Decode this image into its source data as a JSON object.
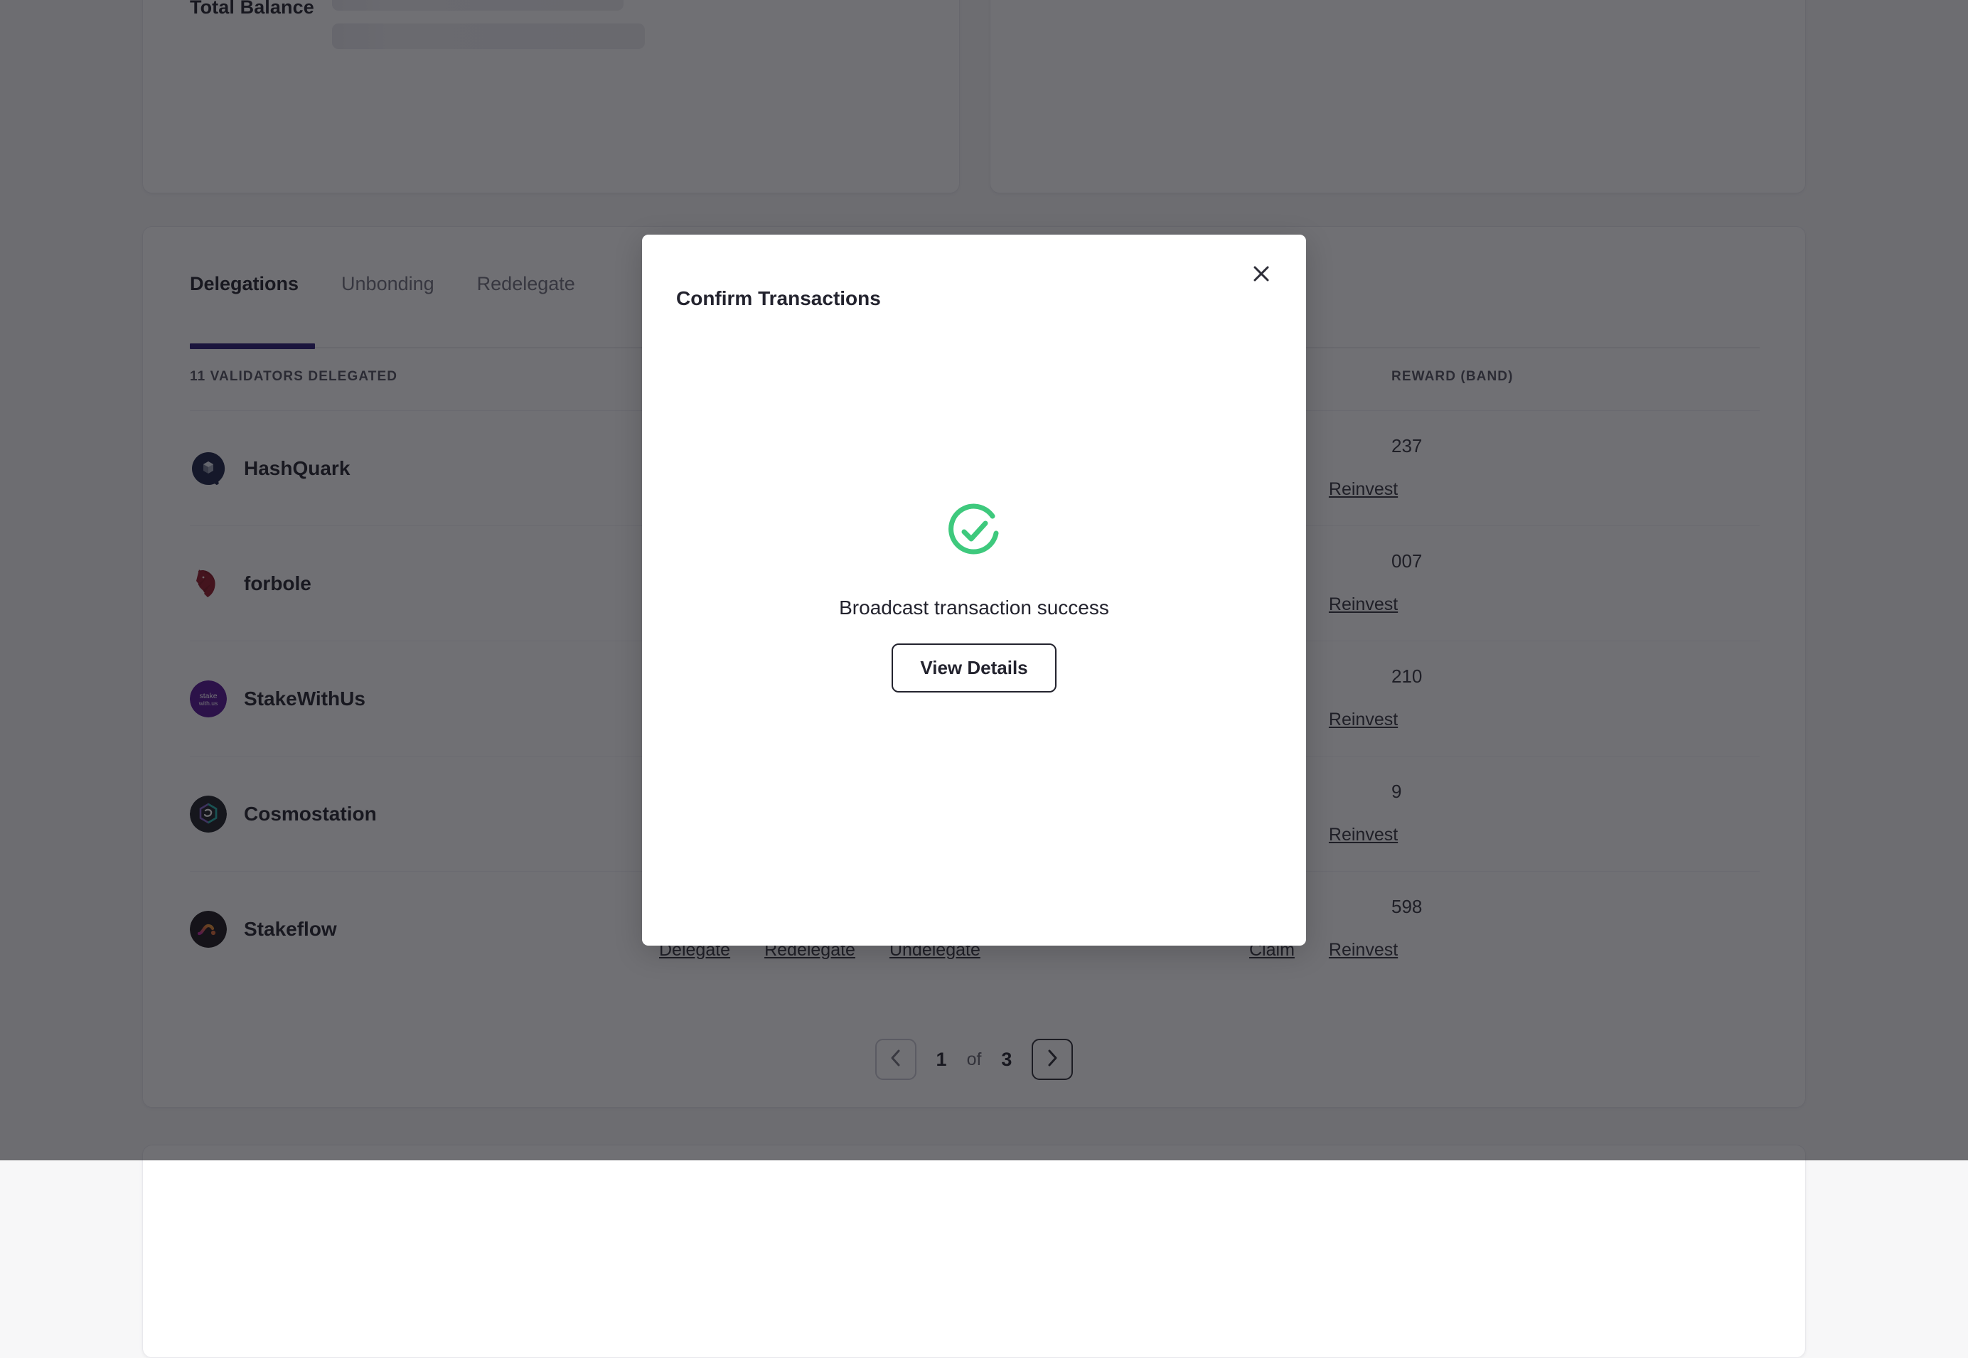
{
  "cards": {
    "balance_title": "Total Balance"
  },
  "tabs": [
    {
      "label": "Delegations",
      "active": true
    },
    {
      "label": "Unbonding",
      "active": false
    },
    {
      "label": "Redelegate",
      "active": false
    }
  ],
  "table": {
    "header_validators": "11 VALIDATORS DELEGATED",
    "header_reward": "REWARD (BAND)",
    "actions": [
      "Delegate",
      "Redelegate",
      "Undelegate"
    ],
    "actions_right": [
      "Claim",
      "Reinvest"
    ],
    "rows": [
      {
        "name": "HashQuark",
        "logo": "hashquark-logo",
        "reward": "237"
      },
      {
        "name": "forbole",
        "logo": "forbole-logo",
        "reward": "007"
      },
      {
        "name": "StakeWithUs",
        "logo": "stakewithus-logo",
        "reward": "210"
      },
      {
        "name": "Cosmostation",
        "logo": "cosmostation-logo",
        "reward": "9"
      },
      {
        "name": "Stakeflow",
        "logo": "stakeflow-logo",
        "reward": "598"
      }
    ]
  },
  "pagination": {
    "prev_icon": "chevron-left-icon",
    "next_icon": "chevron-right-icon",
    "current_page": "1",
    "of_label": "of",
    "total_pages": "3"
  },
  "modal": {
    "title": "Confirm Transactions",
    "close_icon": "close-icon",
    "success_icon": "check-circle-icon",
    "success_message": "Broadcast transaction success",
    "primary_button": "View Details"
  },
  "colors": {
    "accent": "#20126e",
    "success": "#3ec97d",
    "text": "#23232e",
    "overlay": "rgba(25,25,30,0.62)"
  }
}
